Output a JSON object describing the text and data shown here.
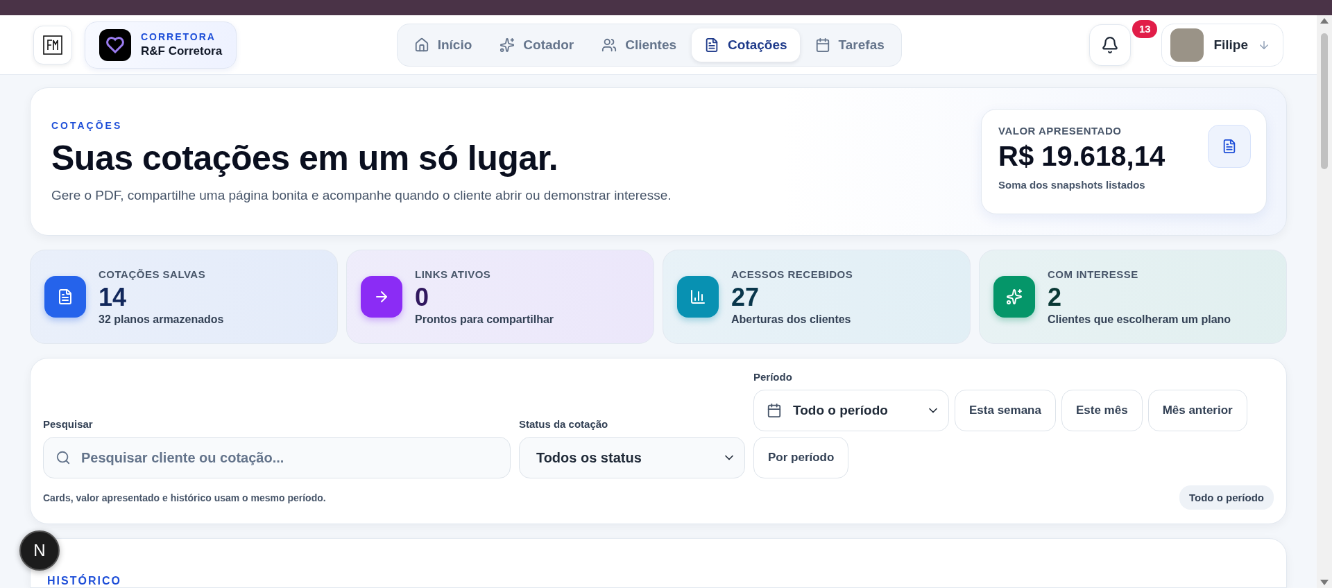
{
  "top_nav": {
    "brand": {
      "label": "CORRETORA",
      "name": "R&F Corretora"
    },
    "tabs": [
      {
        "label": "Início",
        "kind": "home",
        "selected": false
      },
      {
        "label": "Cotador",
        "kind": "sparkles",
        "selected": false
      },
      {
        "label": "Clientes",
        "kind": "users",
        "selected": false
      },
      {
        "label": "Cotações",
        "kind": "document",
        "selected": true
      },
      {
        "label": "Tarefas",
        "kind": "calendar",
        "selected": false
      }
    ],
    "notifications": {
      "count": "13"
    },
    "user": {
      "name": "Filipe"
    }
  },
  "hero": {
    "eyebrow": "COTAÇÕES",
    "title": "Suas cotações em um só lugar.",
    "description": "Gere o PDF, compartilhe uma página bonita e acompanhe quando o cliente abrir ou demonstrar interesse.",
    "summary": {
      "label": "VALOR APRESENTADO",
      "value": "R$ 19.618,14",
      "note": "Soma dos snapshots listados"
    }
  },
  "stats": [
    {
      "kind": "document",
      "label": "COTAÇÕES SALVAS",
      "value": "14",
      "note": "32 planos armazenados",
      "color": "#2563eb"
    },
    {
      "kind": "arrow",
      "label": "LINKS ATIVOS",
      "value": "0",
      "note": "Prontos para compartilhar",
      "color": "#8b2cf5"
    },
    {
      "kind": "chart",
      "label": "ACESSOS RECEBIDOS",
      "value": "27",
      "note": "Aberturas dos clientes",
      "color": "#0891b2"
    },
    {
      "kind": "sparkle",
      "label": "COM INTERESSE",
      "value": "2",
      "note": "Clientes que escolheram um plano",
      "color": "#059669"
    }
  ],
  "filters": {
    "search": {
      "label": "Pesquisar",
      "placeholder": "Pesquisar cliente ou cotação..."
    },
    "status": {
      "label": "Status da cotação",
      "value": "Todos os status"
    },
    "period": {
      "label": "Período",
      "value": "Todo o período",
      "presets": [
        "Esta semana",
        "Este mês",
        "Mês anterior",
        "Por período"
      ]
    },
    "note": "Cards, valor apresentado e histórico usam o mesmo período.",
    "active_period": "Todo o período"
  },
  "history": {
    "eyebrow": "HISTÓRICO"
  },
  "dev_badge": "N"
}
